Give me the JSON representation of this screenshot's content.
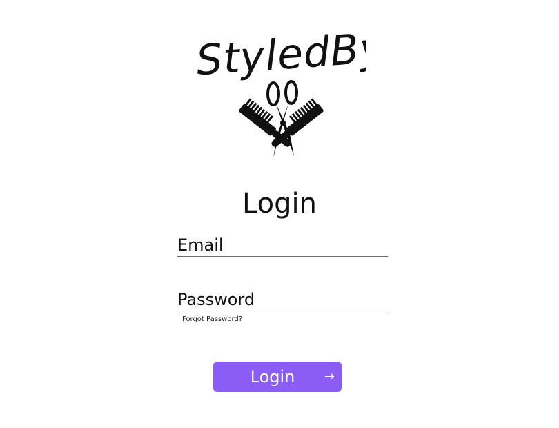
{
  "logo": {
    "wordmark": "StyledBy",
    "emblem_icon": "scissors-and-combs-icon"
  },
  "form": {
    "title": "Login",
    "email": {
      "placeholder": "Email",
      "value": ""
    },
    "password": {
      "placeholder": "Password",
      "value": ""
    },
    "forgot_password_label": "Forgot Password?",
    "submit": {
      "label": "Login",
      "icon": "arrow-right-icon",
      "icon_glyph": "→"
    }
  },
  "colors": {
    "accent": "#8b5cf6",
    "text": "#111111",
    "underline": "#6b6b6b",
    "background": "#ffffff"
  }
}
